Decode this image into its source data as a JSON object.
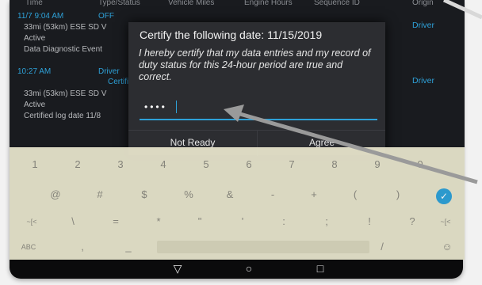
{
  "log": {
    "headers": [
      "Time",
      "Type/Status",
      "Vehicle Miles",
      "Engine Hours",
      "Sequence ID",
      "Origin"
    ],
    "event1": {
      "time": "11/7 9:04 AM",
      "status": "OFF",
      "location": "33mi (53km) ESE SD V",
      "line2": "Active",
      "line3": "Data Diagnostic Event",
      "origin": "Driver"
    },
    "event2": {
      "time": "10:27 AM",
      "status": "Driver",
      "status2": "Certifi",
      "location": "33mi (53km) ESE SD V",
      "line2": "Active",
      "line3": "Certified log date 11/8",
      "origin": "Driver"
    }
  },
  "dialog": {
    "title": "Certify the following date: 11/15/2019",
    "message": "I hereby certify that my data entries and my record of duty status for this 24-hour period are true and correct.",
    "password_mask": "••••",
    "buttons": {
      "not_ready": "Not Ready",
      "agree": "Agree"
    }
  },
  "keyboard": {
    "row1": [
      "1",
      "2",
      "3",
      "4",
      "5",
      "6",
      "7",
      "8",
      "9",
      "0"
    ],
    "row2": [
      "@",
      "#",
      "$",
      "%",
      "&",
      "-",
      "+",
      "(",
      ")"
    ],
    "row3": [
      "~[<",
      "\\",
      "=",
      "*",
      "\"",
      "'",
      ":",
      ";",
      "!",
      "?",
      "~[<"
    ],
    "row4": [
      "ABC",
      ",",
      "_",
      "/"
    ],
    "enter_icon": "check-icon",
    "emoji_icon": "smiley-icon"
  },
  "nav": {
    "back_icon": "back-triangle-icon",
    "home_icon": "home-circle-icon",
    "recents_icon": "recents-square-icon"
  },
  "colors": {
    "accent": "#2ea1d8",
    "screen_bg": "#191b1f",
    "dialog_bg": "#2c2d31",
    "keyboard_bg": "#e7e4cc"
  }
}
